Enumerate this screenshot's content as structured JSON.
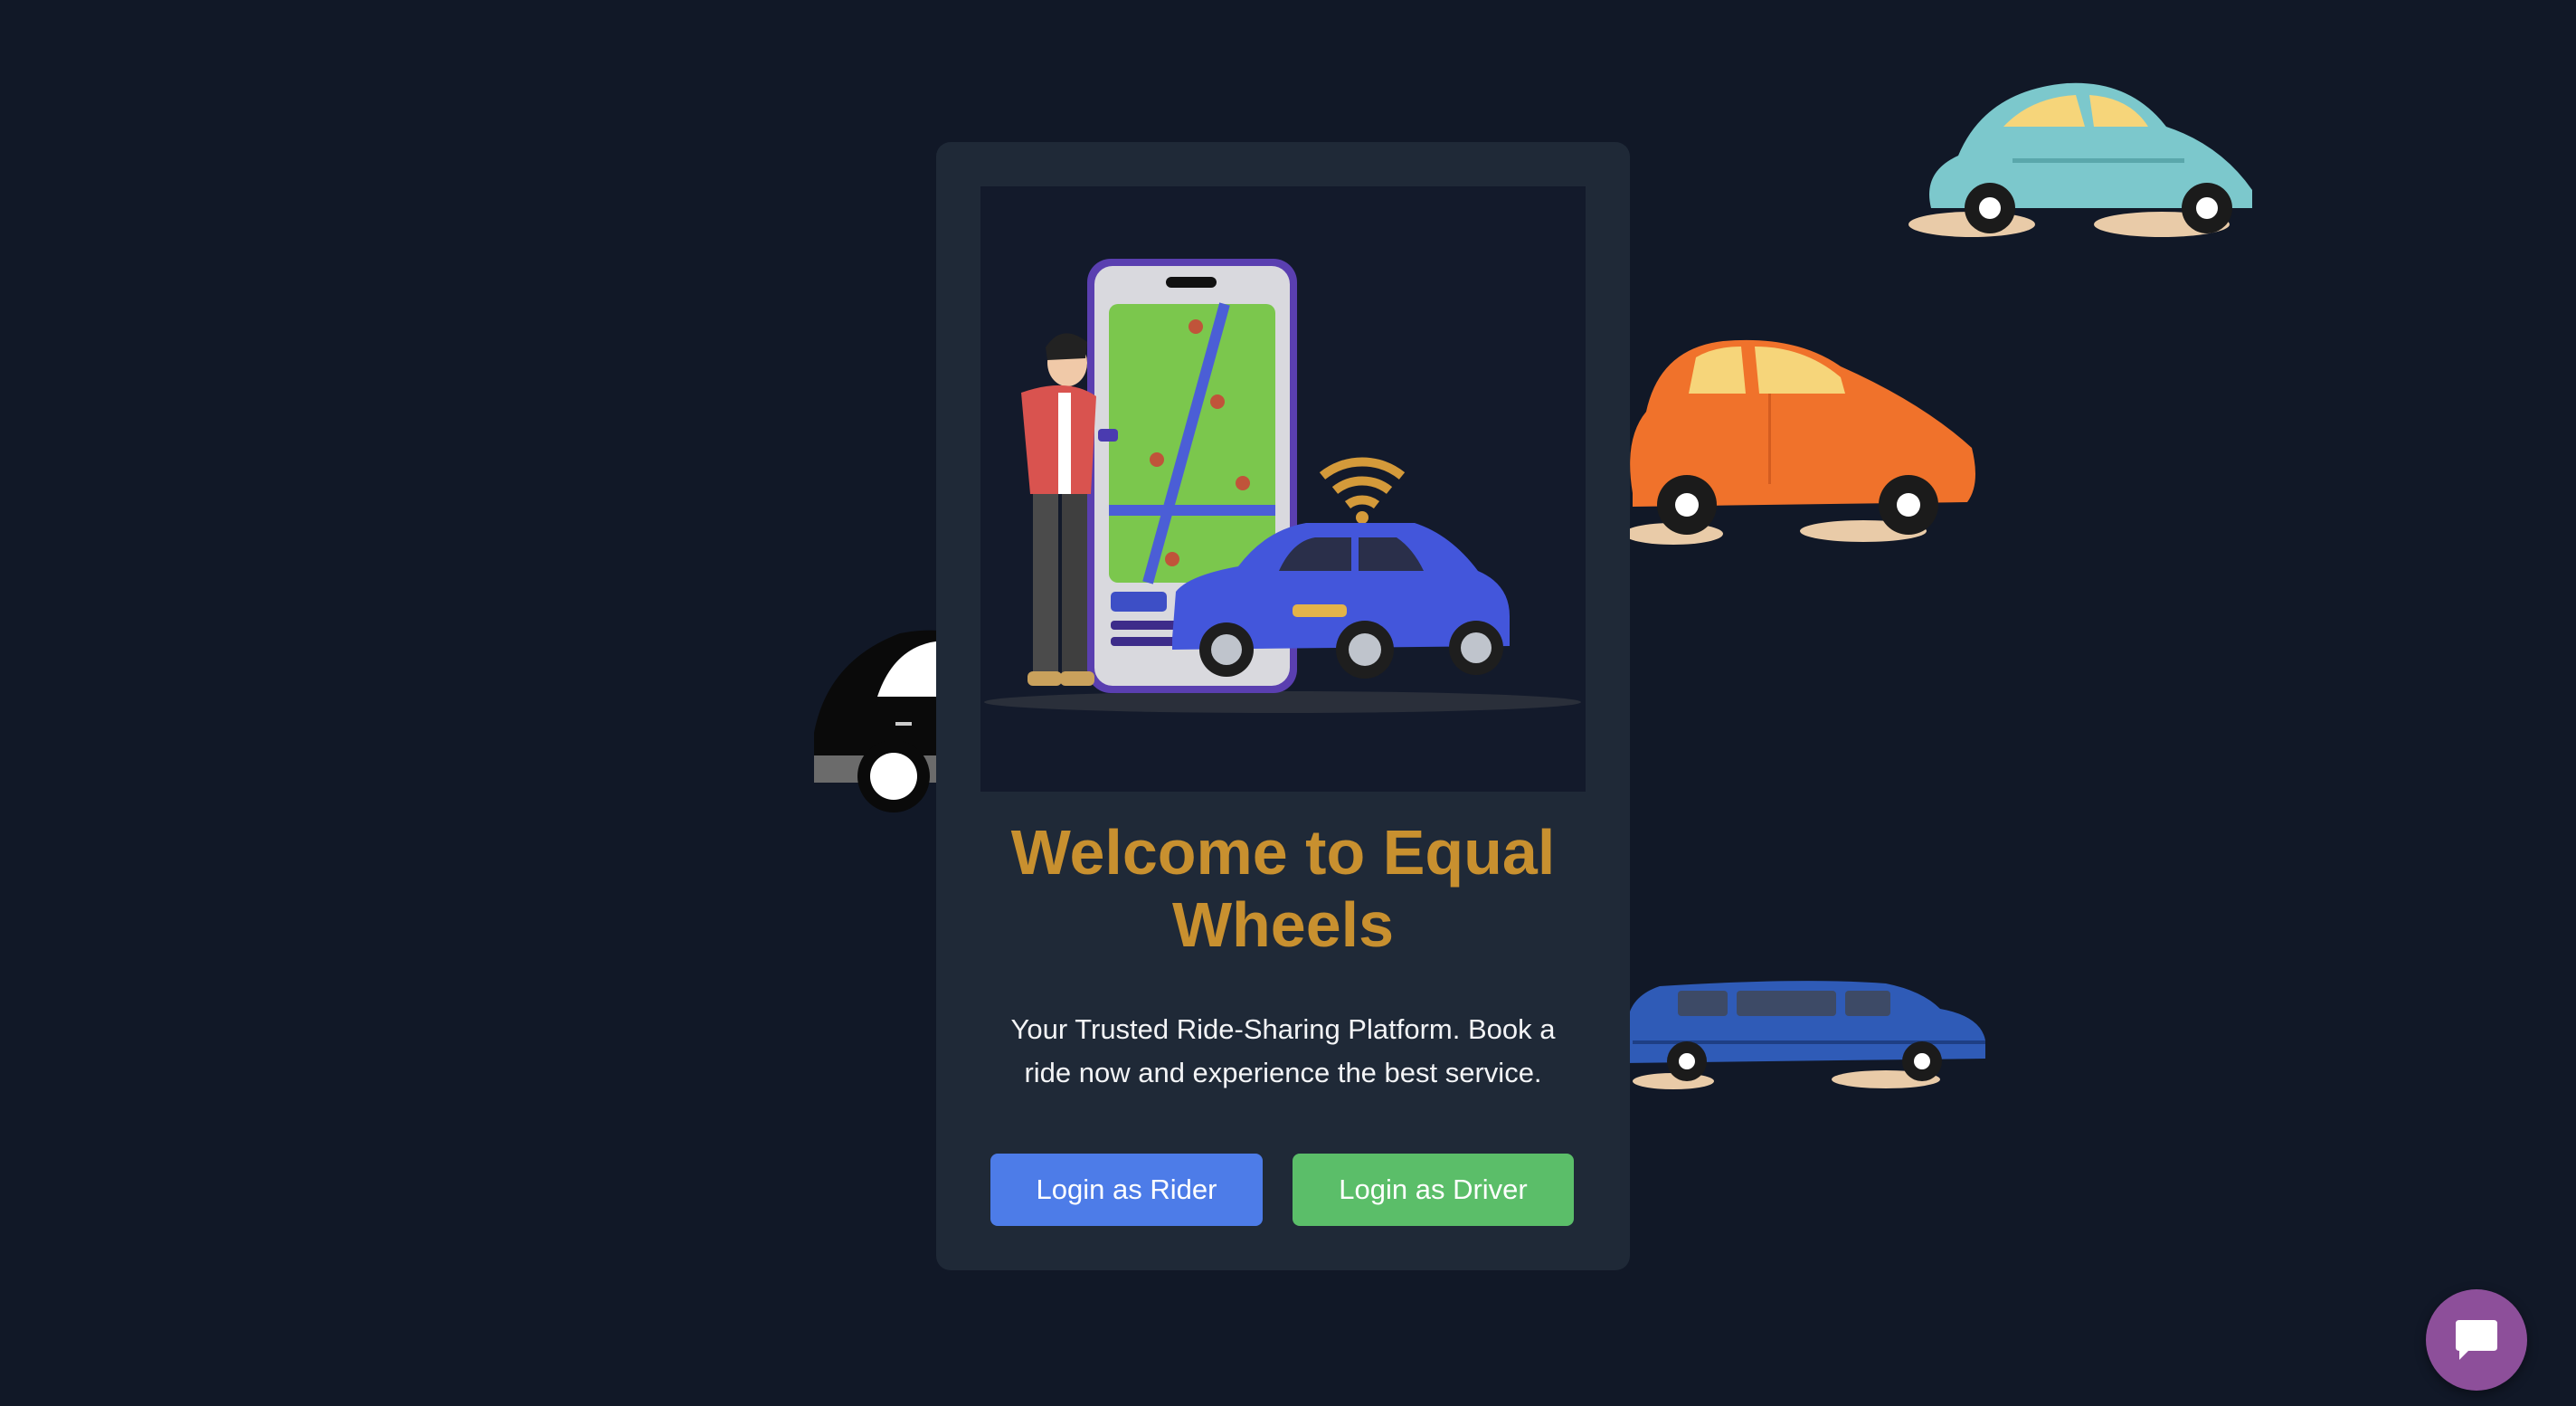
{
  "welcome": {
    "title": "Welcome to Equal Wheels",
    "subtitle": "Your Trusted Ride-Sharing Platform. Book a ride now and experience the best service."
  },
  "actions": {
    "rider_label": "Login as Rider",
    "driver_label": "Login as Driver"
  },
  "icons": {
    "chat": "chat-bubble-icon"
  },
  "colors": {
    "background": "#111827",
    "card": "#1f2937",
    "title": "#c8902f",
    "rider_button": "#4d7ce8",
    "driver_button": "#5bbe69",
    "chat_button": "#8d4f9a"
  }
}
